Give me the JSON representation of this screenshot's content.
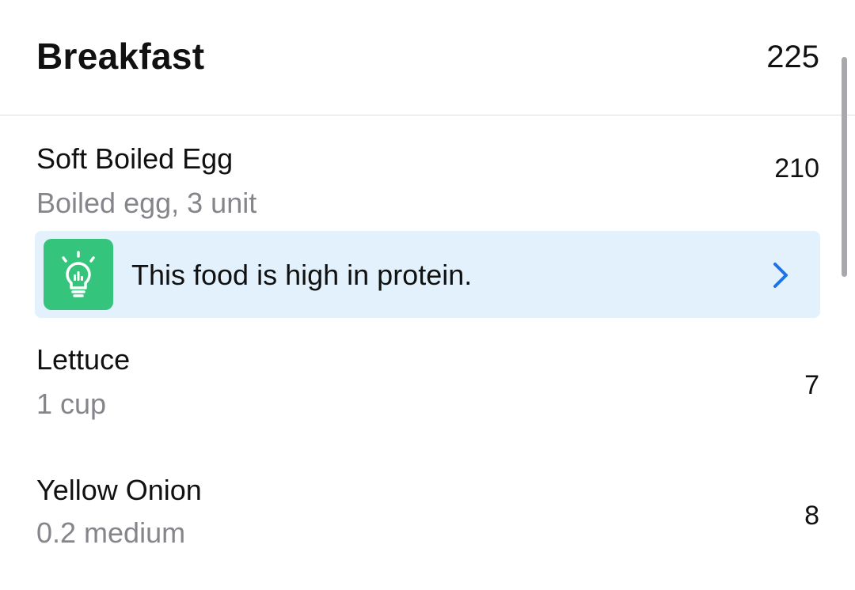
{
  "meal": {
    "title": "Breakfast",
    "total_calories": "225"
  },
  "foods": [
    {
      "name": "Soft Boiled Egg",
      "serving": "Boiled egg, 3 unit",
      "calories": "210"
    },
    {
      "name": "Lettuce",
      "serving": "1 cup",
      "calories": "7"
    },
    {
      "name": "Yellow Onion",
      "serving": "0.2 medium",
      "calories": "8"
    }
  ],
  "tip": {
    "icon": "lightbulb-icon",
    "text": "This food is high in protein.",
    "chevron_icon": "chevron-right-icon"
  },
  "colors": {
    "tip_background": "#e2f1fb",
    "tip_icon_background": "#34c47c",
    "chevron": "#1a73e8",
    "secondary_text": "#85858b"
  }
}
